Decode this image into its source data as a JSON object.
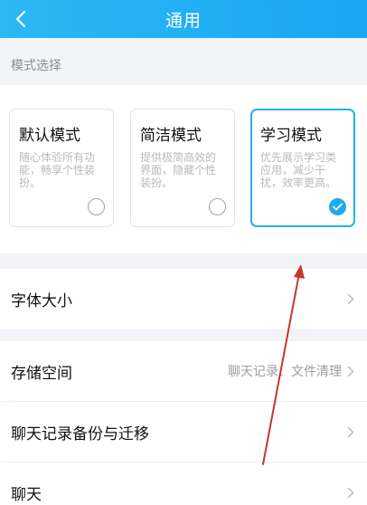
{
  "header": {
    "title": "通用",
    "back_icon": "chevron-left-icon"
  },
  "mode_section": {
    "label": "模式选择",
    "modes": [
      {
        "title": "默认模式",
        "desc": "随心体验所有功能，畅享个性装扮。",
        "selected": false
      },
      {
        "title": "简洁模式",
        "desc": "提供极简高效的界面，隐藏个性装扮。",
        "selected": false
      },
      {
        "title": "学习模式",
        "desc": "优先展示学习类应用，减少干扰，效率更高。",
        "selected": true
      }
    ]
  },
  "rows": [
    {
      "label": "字体大小",
      "value": ""
    },
    {
      "label": "存储空间",
      "value": "聊天记录、文件清理"
    },
    {
      "label": "聊天记录备份与迁移",
      "value": ""
    },
    {
      "label": "聊天",
      "value": ""
    }
  ],
  "colors": {
    "accent": "#22b1f0",
    "annotation_arrow": "#c0392b"
  }
}
